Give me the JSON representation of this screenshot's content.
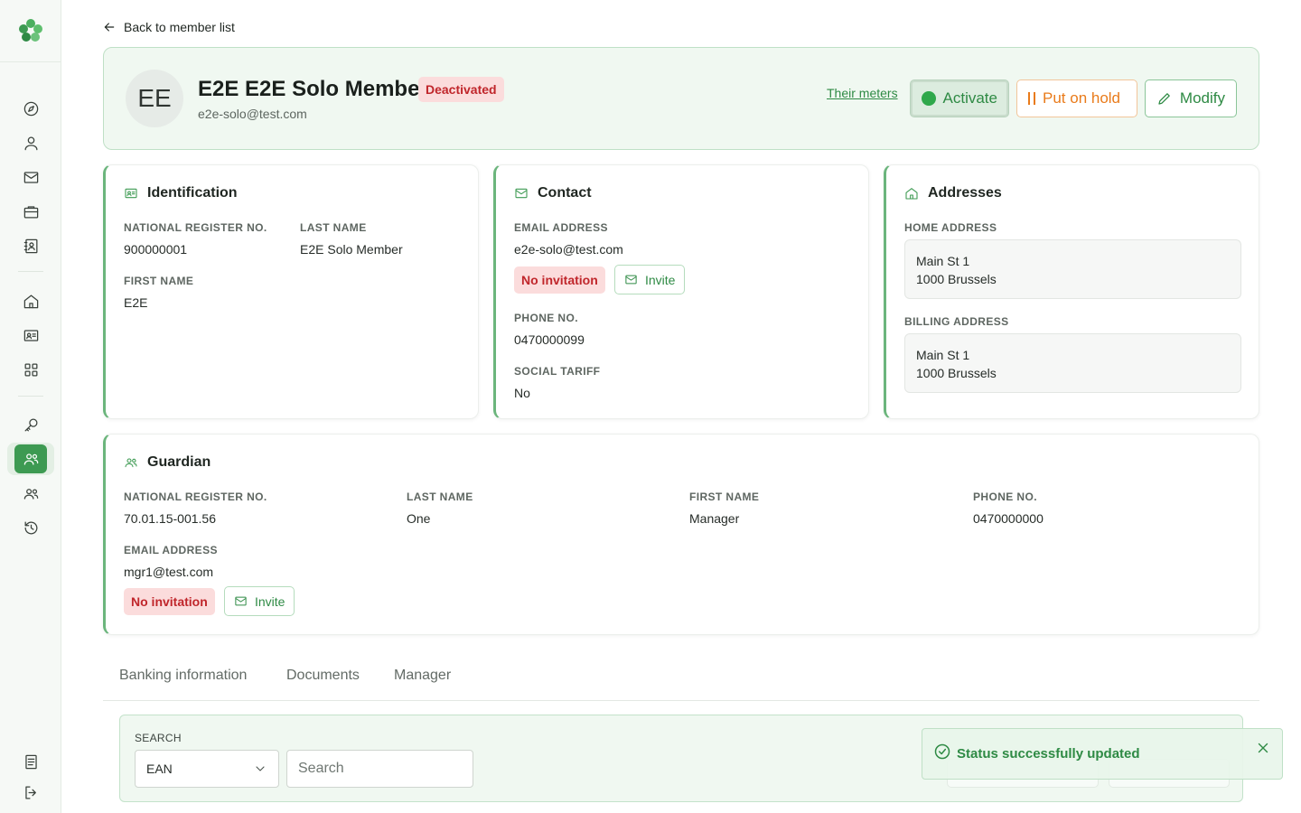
{
  "nav": {
    "back_label": "Back to member list"
  },
  "member": {
    "initials": "EE",
    "name": "E2E E2E Solo Member",
    "status": "Deactivated",
    "email": "e2e-solo@test.com",
    "meters_link": "Their meters",
    "actions": {
      "activate": "Activate",
      "hold": "Put on hold",
      "modify": "Modify"
    }
  },
  "identification": {
    "title": "Identification",
    "national_register_label": "NATIONAL REGISTER NO.",
    "national_register": "900000001",
    "last_name_label": "LAST NAME",
    "last_name": "E2E Solo Member",
    "first_name_label": "FIRST NAME",
    "first_name": "E2E"
  },
  "contact": {
    "title": "Contact",
    "email_label": "EMAIL ADDRESS",
    "email": "e2e-solo@test.com",
    "invitation_status": "No invitation",
    "invite_label": "Invite",
    "phone_label": "PHONE NO.",
    "phone": "0470000099",
    "social_tariff_label": "SOCIAL TARIFF",
    "social_tariff": "No"
  },
  "addresses": {
    "title": "Addresses",
    "home_label": "HOME ADDRESS",
    "home_line1": "Main St 1",
    "home_line2": "1000 Brussels",
    "billing_label": "BILLING ADDRESS",
    "billing_line1": "Main St 1",
    "billing_line2": "1000 Brussels"
  },
  "guardian": {
    "title": "Guardian",
    "national_register_label": "NATIONAL REGISTER NO.",
    "national_register": "70.01.15-001.56",
    "last_name_label": "LAST NAME",
    "last_name": "One",
    "first_name_label": "FIRST NAME",
    "first_name": "Manager",
    "phone_label": "PHONE NO.",
    "phone": "0470000000",
    "email_label": "EMAIL ADDRESS",
    "email": "mgr1@test.com",
    "invitation_status": "No invitation",
    "invite_label": "Invite"
  },
  "tabs": [
    {
      "label": "Banking information"
    },
    {
      "label": "Documents"
    },
    {
      "label": "Manager"
    }
  ],
  "search": {
    "label": "SEARCH",
    "field_value": "EAN",
    "placeholder": "Search"
  },
  "toast": {
    "message": "Status successfully updated"
  },
  "colors": {
    "brand_green": "#3d9a52",
    "danger": "#c0262b",
    "warning": "#e97b1b"
  }
}
